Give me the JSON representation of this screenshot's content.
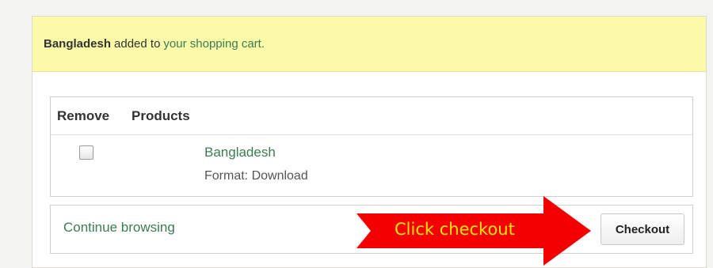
{
  "message": {
    "product": "Bangladesh",
    "text": "added to",
    "cart_link": "your shopping cart."
  },
  "cart": {
    "headers": {
      "remove": "Remove",
      "products": "Products"
    },
    "items": [
      {
        "name": "Bangladesh",
        "format": "Format: Download",
        "checked": false
      }
    ]
  },
  "actions": {
    "continue_label": "Continue browsing",
    "checkout_label": "Checkout"
  },
  "annotation": {
    "label": "Click checkout",
    "arrow_color": "#f30000",
    "label_color": "#ffe600"
  },
  "colors": {
    "message_bg": "#fafaa9",
    "link": "#3d7b55"
  }
}
